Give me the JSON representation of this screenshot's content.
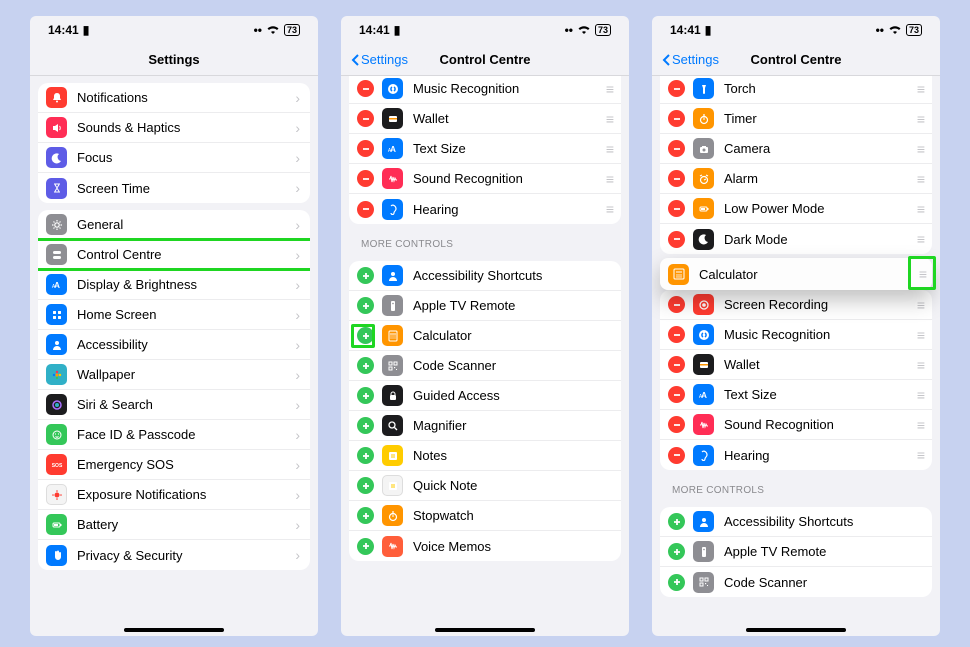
{
  "status": {
    "time": "14:41",
    "battery": "73"
  },
  "phone1": {
    "title": "Settings",
    "rows1": [
      {
        "label": "Notifications",
        "iconClass": "ic-red",
        "glyph": "bell"
      },
      {
        "label": "Sounds & Haptics",
        "iconClass": "ic-pink",
        "glyph": "speaker"
      },
      {
        "label": "Focus",
        "iconClass": "ic-purple",
        "glyph": "moon"
      },
      {
        "label": "Screen Time",
        "iconClass": "ic-purple",
        "glyph": "hourglass"
      }
    ],
    "rows2": [
      {
        "label": "General",
        "iconClass": "ic-grey",
        "glyph": "gear"
      },
      {
        "label": "Control Centre",
        "iconClass": "ic-grey",
        "glyph": "toggles",
        "highlight": true
      },
      {
        "label": "Display & Brightness",
        "iconClass": "ic-blue",
        "glyph": "AA"
      },
      {
        "label": "Home Screen",
        "iconClass": "ic-blue",
        "glyph": "grid"
      },
      {
        "label": "Accessibility",
        "iconClass": "ic-blue",
        "glyph": "person"
      },
      {
        "label": "Wallpaper",
        "iconClass": "ic-teal",
        "glyph": "flower"
      },
      {
        "label": "Siri & Search",
        "iconClass": "ic-black",
        "glyph": "siri"
      },
      {
        "label": "Face ID & Passcode",
        "iconClass": "ic-green",
        "glyph": "face"
      },
      {
        "label": "Emergency SOS",
        "iconClass": "ic-red",
        "glyph": "SOS"
      },
      {
        "label": "Exposure Notifications",
        "iconClass": "ic-white",
        "glyph": "virus"
      },
      {
        "label": "Battery",
        "iconClass": "ic-green",
        "glyph": "battery"
      },
      {
        "label": "Privacy & Security",
        "iconClass": "ic-blue",
        "glyph": "hand"
      }
    ]
  },
  "phone2": {
    "back": "Settings",
    "title": "Control Centre",
    "included": [
      {
        "label": "Music Recognition",
        "iconClass": "ic-blue",
        "glyph": "shazam"
      },
      {
        "label": "Wallet",
        "iconClass": "ic-black",
        "glyph": "wallet"
      },
      {
        "label": "Text Size",
        "iconClass": "ic-blue",
        "glyph": "AA"
      },
      {
        "label": "Sound Recognition",
        "iconClass": "ic-pink",
        "glyph": "wave"
      },
      {
        "label": "Hearing",
        "iconClass": "ic-blue",
        "glyph": "ear"
      }
    ],
    "more_header": "MORE CONTROLS",
    "more": [
      {
        "label": "Accessibility Shortcuts",
        "iconClass": "ic-blue",
        "glyph": "person"
      },
      {
        "label": "Apple TV Remote",
        "iconClass": "ic-grey",
        "glyph": "remote"
      },
      {
        "label": "Calculator",
        "iconClass": "ic-orange",
        "glyph": "calc",
        "highlight": true
      },
      {
        "label": "Code Scanner",
        "iconClass": "ic-grey",
        "glyph": "qr"
      },
      {
        "label": "Guided Access",
        "iconClass": "ic-black",
        "glyph": "lock"
      },
      {
        "label": "Magnifier",
        "iconClass": "ic-black",
        "glyph": "search"
      },
      {
        "label": "Notes",
        "iconClass": "ic-yellow",
        "glyph": "note"
      },
      {
        "label": "Quick Note",
        "iconClass": "ic-white",
        "glyph": "note"
      },
      {
        "label": "Stopwatch",
        "iconClass": "ic-orange",
        "glyph": "timer"
      },
      {
        "label": "Voice Memos",
        "iconClass": "ic-coral",
        "glyph": "wave"
      }
    ]
  },
  "phone3": {
    "back": "Settings",
    "title": "Control Centre",
    "included": [
      {
        "label": "Torch",
        "iconClass": "ic-blue",
        "glyph": "torch"
      },
      {
        "label": "Timer",
        "iconClass": "ic-orange",
        "glyph": "timer"
      },
      {
        "label": "Camera",
        "iconClass": "ic-grey",
        "glyph": "camera"
      },
      {
        "label": "Alarm",
        "iconClass": "ic-orange",
        "glyph": "alarm"
      },
      {
        "label": "Low Power Mode",
        "iconClass": "ic-orange",
        "glyph": "battery"
      },
      {
        "label": "Dark Mode",
        "iconClass": "ic-black",
        "glyph": "moon"
      }
    ],
    "floating": {
      "label": "Calculator",
      "iconClass": "ic-orange",
      "glyph": "calc"
    },
    "included2": [
      {
        "label": "Screen Recording",
        "iconClass": "ic-red",
        "glyph": "record"
      },
      {
        "label": "Music Recognition",
        "iconClass": "ic-blue",
        "glyph": "shazam"
      },
      {
        "label": "Wallet",
        "iconClass": "ic-black",
        "glyph": "wallet"
      },
      {
        "label": "Text Size",
        "iconClass": "ic-blue",
        "glyph": "AA"
      },
      {
        "label": "Sound Recognition",
        "iconClass": "ic-pink",
        "glyph": "wave"
      },
      {
        "label": "Hearing",
        "iconClass": "ic-blue",
        "glyph": "ear"
      }
    ],
    "more_header": "MORE CONTROLS",
    "more": [
      {
        "label": "Accessibility Shortcuts",
        "iconClass": "ic-blue",
        "glyph": "person"
      },
      {
        "label": "Apple TV Remote",
        "iconClass": "ic-grey",
        "glyph": "remote"
      },
      {
        "label": "Code Scanner",
        "iconClass": "ic-grey",
        "glyph": "qr"
      }
    ]
  }
}
